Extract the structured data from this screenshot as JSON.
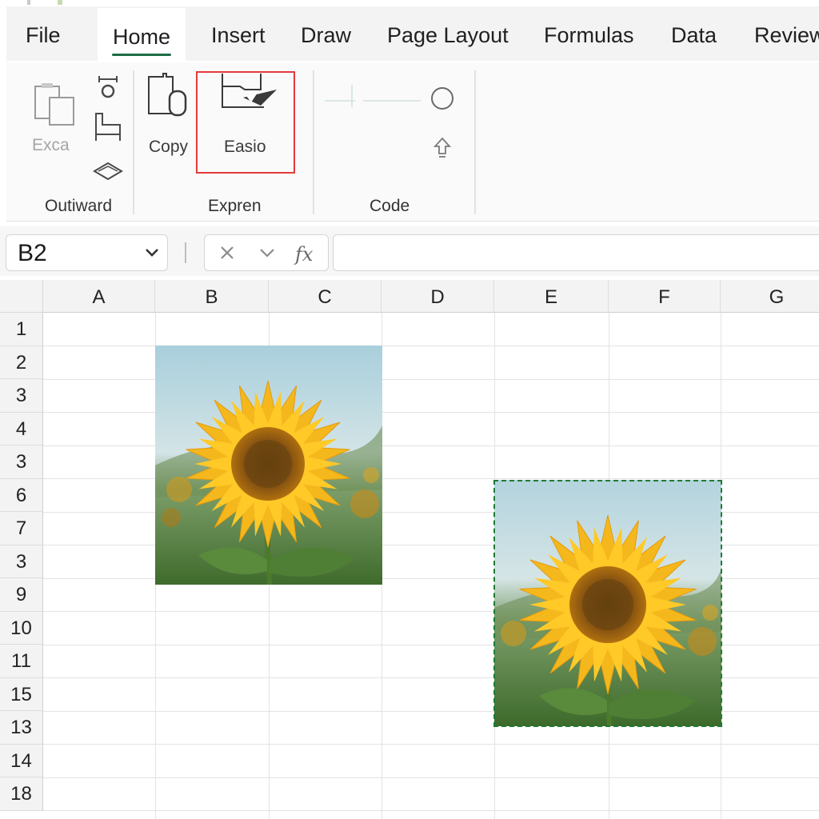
{
  "tabs": [
    {
      "id": "file",
      "label": "File"
    },
    {
      "id": "home",
      "label": "Home",
      "active": true
    },
    {
      "id": "insert",
      "label": "Insert"
    },
    {
      "id": "draw",
      "label": "Draw"
    },
    {
      "id": "page-layout",
      "label": "Page Layout"
    },
    {
      "id": "formulas",
      "label": "Formulas"
    },
    {
      "id": "data",
      "label": "Data"
    },
    {
      "id": "review",
      "label": "Review"
    }
  ],
  "ribbon": {
    "groups": [
      {
        "label": "Outiward",
        "buttons": [
          {
            "label": "Exca",
            "icon": "paste-icon",
            "disabled": true
          }
        ]
      },
      {
        "label": "Expren",
        "buttons": [
          {
            "label": "Copy",
            "icon": "copy-icon"
          },
          {
            "label": "Easio",
            "icon": "picture-tool-icon",
            "highlighted": true
          }
        ]
      },
      {
        "label": "Code",
        "buttons": []
      }
    ],
    "small_icons": [
      "format-painter-icon",
      "chair-icon",
      "eraser-icon",
      "circle-icon",
      "upload-icon"
    ],
    "highlight_color": "#e33a3a"
  },
  "formula_bar": {
    "name_box": "B2",
    "formula": ""
  },
  "sheet": {
    "columns": [
      "A",
      "B",
      "C",
      "D",
      "E",
      "F",
      "G"
    ],
    "rows": [
      "1",
      "2",
      "3",
      "4",
      "3",
      "6",
      "7",
      "3",
      "9",
      "10",
      "11",
      "15",
      "13",
      "14",
      "18"
    ],
    "pictures": [
      {
        "name": "sunflower-picture-1",
        "selected": false
      },
      {
        "name": "sunflower-picture-2",
        "selected": true
      }
    ],
    "selection_color": "#1e7b34"
  }
}
